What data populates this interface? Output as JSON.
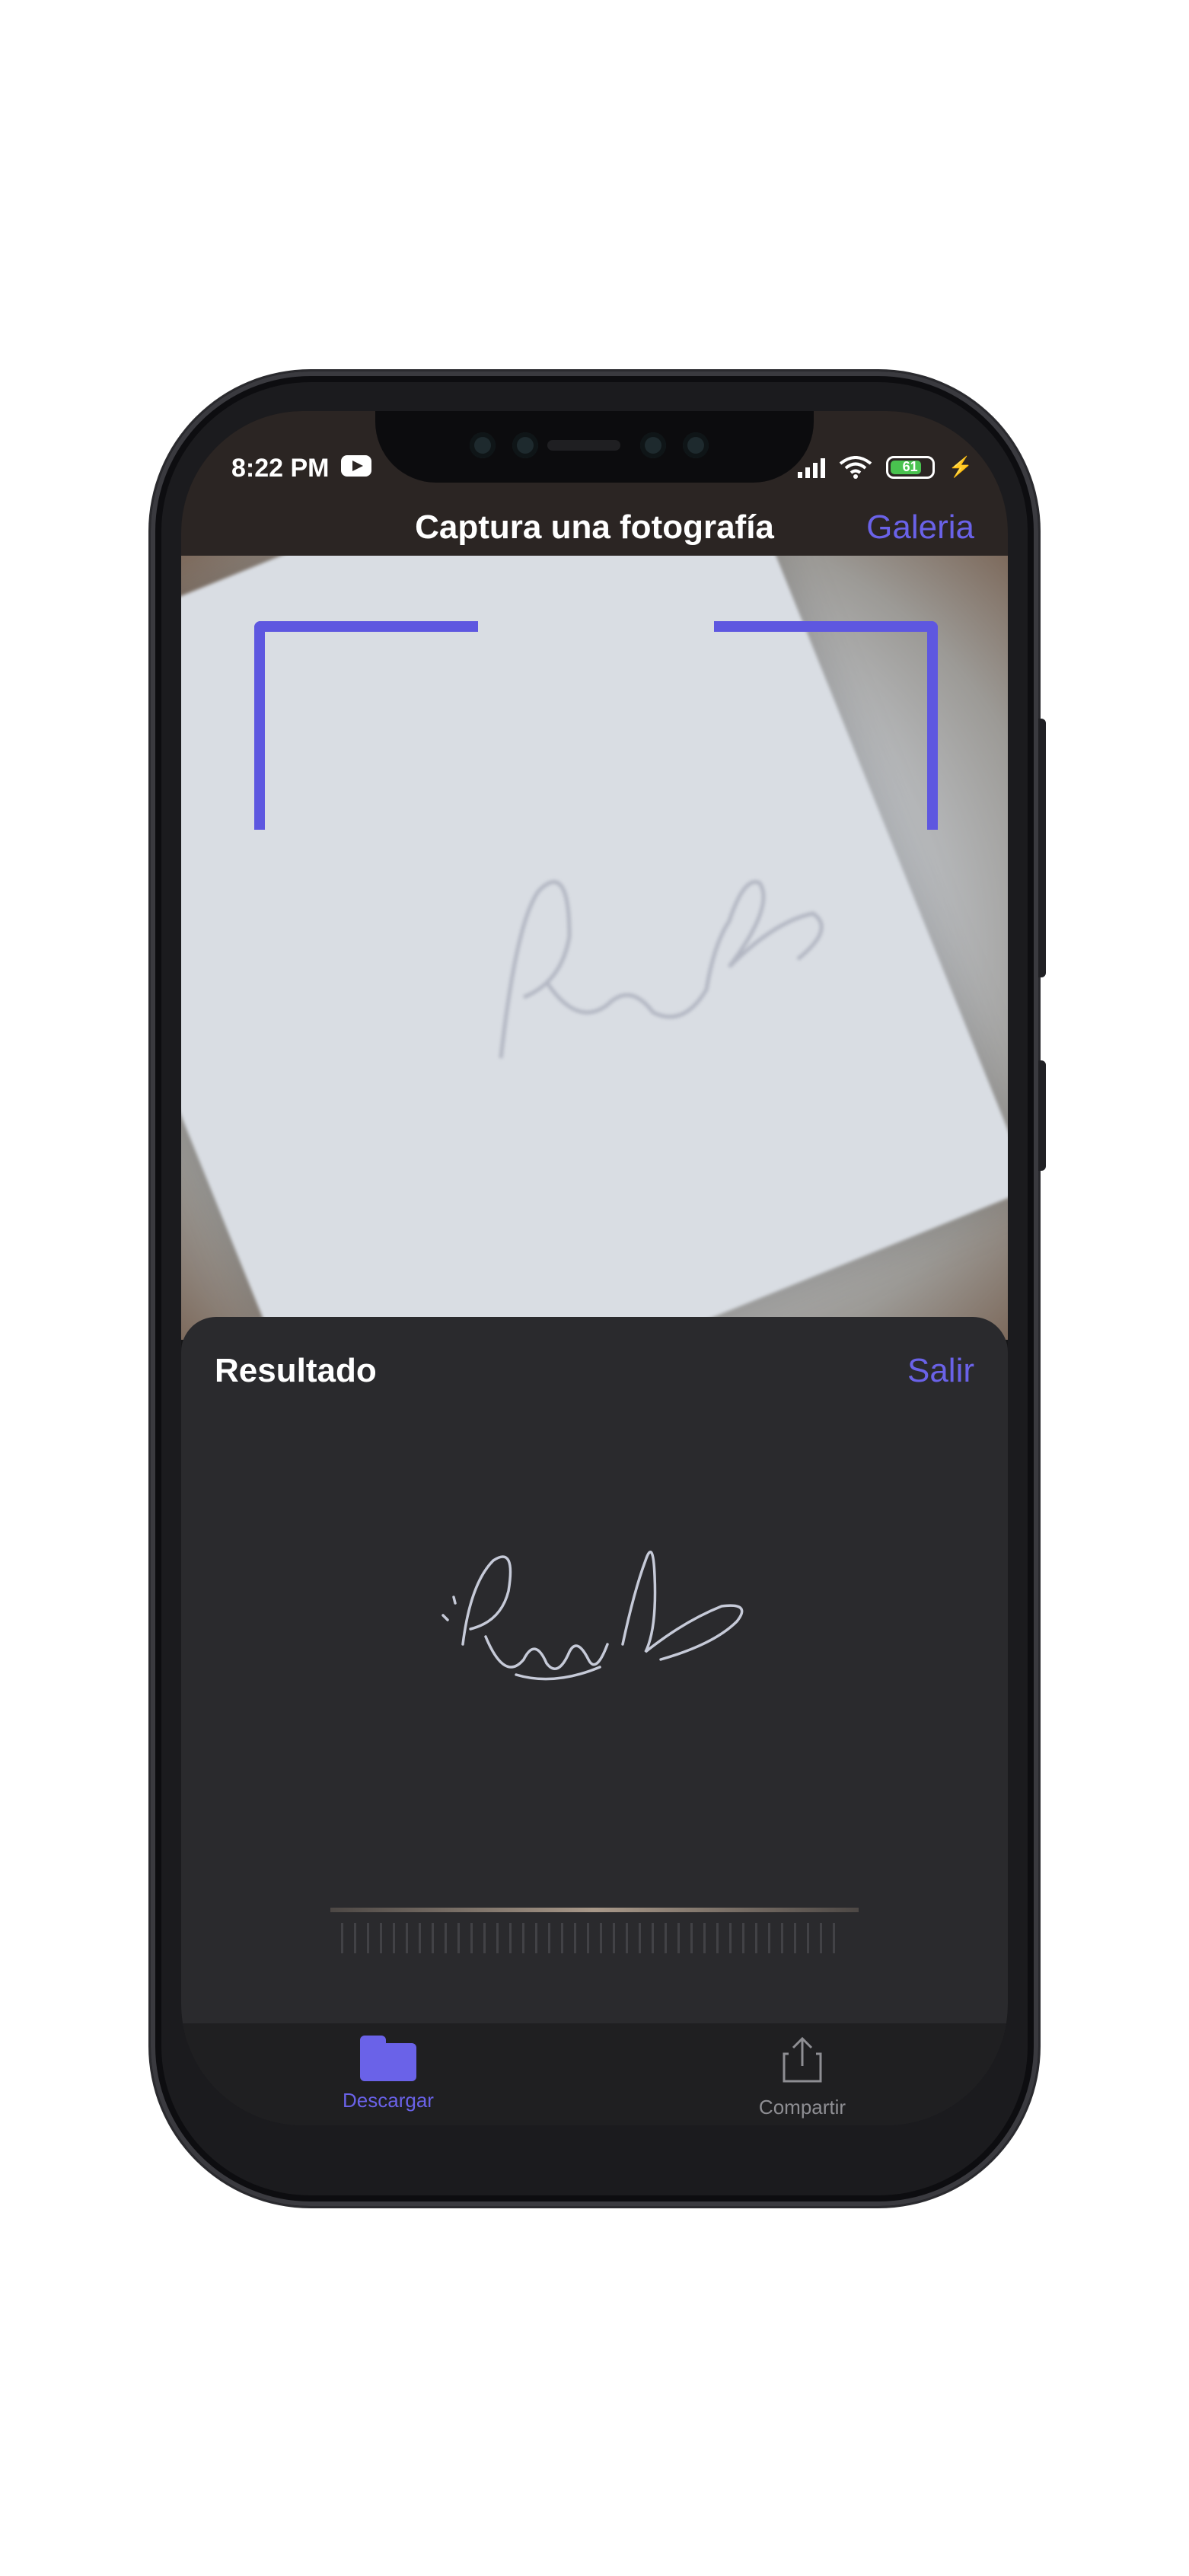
{
  "status_bar": {
    "time": "8:22 PM",
    "battery": "61",
    "icons": [
      "youtube-icon",
      "signal-icon",
      "wifi-icon",
      "battery-icon",
      "charging-icon"
    ]
  },
  "header": {
    "title": "Captura una fotografía",
    "action_label": "Galeria"
  },
  "result_sheet": {
    "title": "Resultado",
    "action_label": "Salir"
  },
  "tab_bar": {
    "tabs": [
      {
        "label": "Descargar",
        "icon": "folder-icon",
        "active": true
      },
      {
        "label": "Compartir",
        "icon": "share-icon",
        "active": false
      }
    ]
  },
  "colors": {
    "accent": "#5e57e0",
    "sheet_background": "#2a2a2d",
    "tab_inactive": "#8e8e93"
  }
}
